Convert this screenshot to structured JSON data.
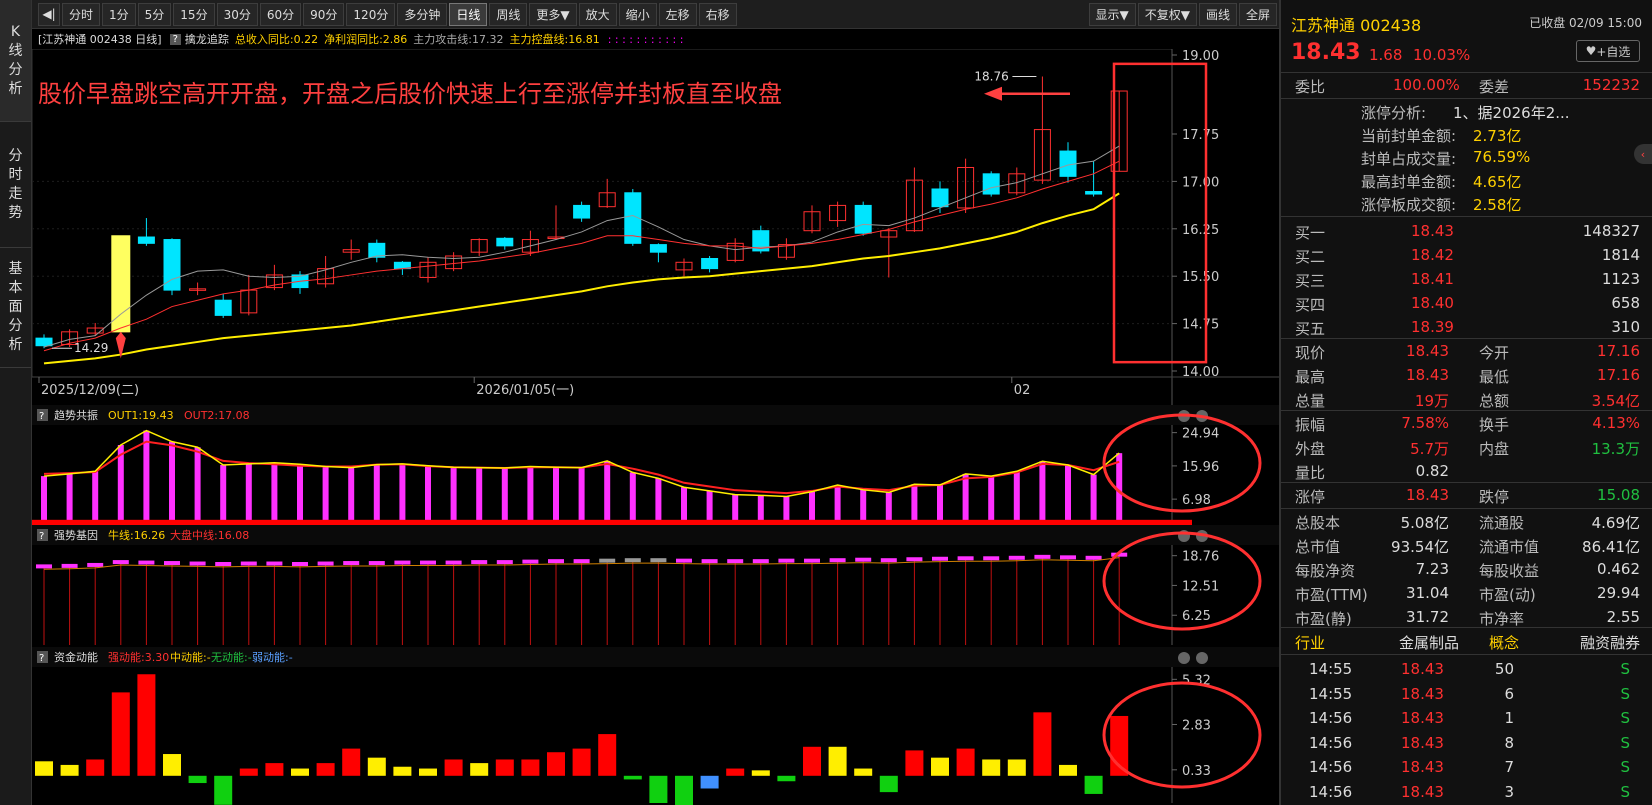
{
  "sidebar": {
    "tabs": [
      "K线分析",
      "分时走势",
      "基本面分析"
    ]
  },
  "toolbar": {
    "items": [
      "分时",
      "1分",
      "5分",
      "15分",
      "30分",
      "60分",
      "90分",
      "120分",
      "多分钟",
      "日线",
      "周线",
      "更多▼",
      "放大",
      "缩小",
      "左移",
      "右移",
      "显示▼",
      "不复权▼",
      "画线",
      "全屏"
    ],
    "active": "日线"
  },
  "infobar": {
    "title": "[江苏神通 002438 日线]",
    "help": "?",
    "indicator": "擒龙追踪",
    "revenue": "总收入同比:0.22",
    "profit": "净利润同比:2.86",
    "attack": "主力攻击线:17.32",
    "control": "主力控盘线:16.81",
    "dots": ": : : : : : : : : : :"
  },
  "main_chart": {
    "annotation": "股价早盘跳空高开开盘，开盘之后股价快速上行至涨停并封板直至收盘",
    "high_label": "18.76",
    "low_label": "14.29",
    "y_ticks": [
      "19.00",
      "17.75",
      "17.00",
      "16.25",
      "15.50",
      "14.75",
      "14.00"
    ],
    "dates": [
      "2025/12/09(二)",
      "2026/01/05(一)",
      "02"
    ]
  },
  "chart_data": {
    "type": "candlestick",
    "ylim": [
      14.0,
      19.0
    ],
    "candles": [
      [
        14.52,
        14.4,
        14.58,
        14.36
      ],
      [
        14.42,
        14.62,
        14.66,
        14.38
      ],
      [
        14.6,
        14.68,
        14.76,
        14.56
      ],
      [
        14.62,
        16.12,
        16.14,
        14.58
      ],
      [
        16.12,
        16.02,
        16.42,
        15.98
      ],
      [
        16.08,
        15.28,
        16.1,
        15.2
      ],
      [
        15.3,
        15.3,
        15.4,
        15.2
      ],
      [
        15.12,
        14.88,
        15.22,
        14.84
      ],
      [
        14.92,
        15.28,
        15.52,
        14.88
      ],
      [
        15.32,
        15.52,
        15.68,
        15.28
      ],
      [
        15.52,
        15.32,
        15.58,
        15.22
      ],
      [
        15.38,
        15.62,
        15.82,
        15.32
      ],
      [
        15.88,
        15.92,
        16.08,
        15.76
      ],
      [
        16.02,
        15.8,
        16.08,
        15.72
      ],
      [
        15.72,
        15.62,
        15.74,
        15.52
      ],
      [
        15.48,
        15.72,
        15.8,
        15.4
      ],
      [
        15.62,
        15.82,
        15.88,
        15.58
      ],
      [
        15.88,
        16.08,
        16.1,
        15.82
      ],
      [
        16.1,
        15.98,
        16.12,
        15.92
      ],
      [
        15.88,
        16.08,
        16.22,
        15.82
      ],
      [
        16.12,
        16.12,
        16.62,
        16.08
      ],
      [
        16.62,
        16.42,
        16.68,
        16.36
      ],
      [
        16.6,
        16.82,
        17.04,
        16.58
      ],
      [
        16.82,
        16.02,
        16.88,
        15.98
      ],
      [
        16.0,
        15.88,
        16.02,
        15.72
      ],
      [
        15.6,
        15.72,
        15.78,
        15.5
      ],
      [
        15.78,
        15.62,
        15.82,
        15.56
      ],
      [
        15.75,
        16.02,
        16.1,
        15.72
      ],
      [
        16.22,
        15.9,
        16.3,
        15.86
      ],
      [
        15.8,
        16.0,
        16.1,
        15.76
      ],
      [
        16.22,
        16.52,
        16.62,
        16.18
      ],
      [
        16.38,
        16.62,
        16.68,
        16.28
      ],
      [
        16.62,
        16.18,
        16.68,
        16.14
      ],
      [
        16.12,
        16.22,
        16.26,
        15.48
      ],
      [
        16.22,
        17.02,
        17.22,
        16.2
      ],
      [
        16.88,
        16.6,
        17.0,
        16.5
      ],
      [
        16.58,
        17.22,
        17.36,
        16.5
      ],
      [
        17.12,
        16.8,
        17.16,
        16.76
      ],
      [
        16.82,
        17.12,
        17.22,
        16.78
      ],
      [
        17.02,
        17.82,
        18.66,
        16.96
      ],
      [
        17.48,
        17.08,
        17.62,
        16.98
      ],
      [
        16.84,
        16.8,
        17.32,
        16.76
      ],
      [
        17.16,
        18.43,
        18.43,
        17.16
      ]
    ],
    "ma_red": [
      14.32,
      14.44,
      14.52,
      14.68,
      14.82,
      15.02,
      15.12,
      15.22,
      15.28,
      15.36,
      15.42,
      15.46,
      15.52,
      15.58,
      15.62,
      15.66,
      15.7,
      15.74,
      15.8,
      15.86,
      15.94,
      16.02,
      16.14,
      16.14,
      16.08,
      16.02,
      15.98,
      15.98,
      15.94,
      15.98,
      16.02,
      16.08,
      16.16,
      16.24,
      16.36,
      16.46,
      16.56,
      16.64,
      16.74,
      16.88,
      17.0,
      17.12,
      17.32
    ],
    "ma_yel": [
      14.12,
      14.16,
      14.2,
      14.26,
      14.34,
      14.4,
      14.46,
      14.52,
      14.56,
      14.6,
      14.64,
      14.68,
      14.72,
      14.78,
      14.84,
      14.9,
      14.96,
      15.02,
      15.08,
      15.14,
      15.2,
      15.26,
      15.34,
      15.4,
      15.45,
      15.48,
      15.5,
      15.54,
      15.58,
      15.62,
      15.66,
      15.72,
      15.78,
      15.82,
      15.88,
      15.94,
      16.02,
      16.1,
      16.2,
      16.34,
      16.46,
      16.56,
      16.81
    ],
    "ma_gry": [
      14.38,
      14.5,
      14.56,
      14.9,
      15.2,
      15.45,
      15.58,
      15.6,
      15.5,
      15.48,
      15.5,
      15.6,
      15.72,
      15.82,
      15.84,
      15.8,
      15.78,
      15.8,
      15.88,
      15.98,
      16.08,
      16.2,
      16.38,
      16.46,
      16.28,
      16.08,
      15.98,
      15.92,
      15.96,
      15.98,
      16.04,
      16.2,
      16.32,
      16.3,
      16.42,
      16.58,
      16.74,
      16.9,
      16.98,
      17.12,
      17.26,
      17.32,
      17.56
    ],
    "trend": {
      "title": "趋势共振",
      "out1": "OUT1:19.43",
      "out2": "OUT2:17.08",
      "ticks": [
        "24.94",
        "15.96",
        "6.98"
      ],
      "ylim": [
        0,
        27
      ],
      "bars": [
        13.2,
        13.8,
        14.5,
        21.6,
        25.5,
        22.5,
        21.0,
        16.2,
        16.5,
        16.8,
        16.4,
        15.8,
        15.5,
        16.3,
        16.5,
        16.0,
        15.6,
        15.5,
        15.4,
        15.8,
        15.6,
        15.5,
        17.3,
        14.2,
        12.6,
        10.2,
        9.2,
        8.2,
        8.0,
        7.7,
        9.0,
        10.8,
        9.5,
        8.8,
        11.0,
        10.8,
        13.8,
        13.2,
        14.5,
        17.2,
        16.2,
        13.6,
        19.4
      ],
      "line_red": [
        13.8,
        14.0,
        14.3,
        19.0,
        22.5,
        21.5,
        19.8,
        17.3,
        16.7,
        16.4,
        16.0,
        15.8,
        15.8,
        16.3,
        16.4,
        15.9,
        15.6,
        15.5,
        15.4,
        15.6,
        15.6,
        15.5,
        16.5,
        15.2,
        13.6,
        11.4,
        10.4,
        9.4,
        9.0,
        8.6,
        9.2,
        10.4,
        9.8,
        9.4,
        10.6,
        10.8,
        12.6,
        13.0,
        14.2,
        16.5,
        16.2,
        14.8,
        17.08
      ],
      "line_yel": [
        13.2,
        13.8,
        14.5,
        21.6,
        25.5,
        22.5,
        21.0,
        16.2,
        16.5,
        16.8,
        16.4,
        15.8,
        15.5,
        16.3,
        16.5,
        16.0,
        15.6,
        15.5,
        15.4,
        15.8,
        15.6,
        15.5,
        17.3,
        14.2,
        12.6,
        10.2,
        9.2,
        8.2,
        8.0,
        7.7,
        9.0,
        10.8,
        9.5,
        8.8,
        11.0,
        10.8,
        13.8,
        13.2,
        14.5,
        17.2,
        16.2,
        13.6,
        19.43
      ]
    },
    "strong": {
      "title": "强势基因",
      "bull": "牛线:16.26",
      "market": "大盘中线:16.08",
      "ticks": [
        "18.76",
        "12.51",
        "6.25"
      ],
      "ylim": [
        0,
        21
      ],
      "bars": [
        16.3,
        16.4,
        16.6,
        17.2,
        17.1,
        17.0,
        16.9,
        16.8,
        16.9,
        16.9,
        16.8,
        16.9,
        17.0,
        17.0,
        17.1,
        17.1,
        17.1,
        17.2,
        17.2,
        17.3,
        17.4,
        17.4,
        17.5,
        17.6,
        17.6,
        17.5,
        17.4,
        17.4,
        17.4,
        17.5,
        17.5,
        17.6,
        17.7,
        17.6,
        17.8,
        17.9,
        18.0,
        18.0,
        18.1,
        18.3,
        18.2,
        18.1,
        18.76
      ]
    },
    "fund": {
      "title": "资金动能",
      "strong": "强动能:3.30",
      "mid": "中动能:-",
      "none": "无动能:-",
      "weak": "弱动能:-",
      "ticks": [
        "5.32",
        "2.83",
        "0.33"
      ],
      "ylim": [
        -1.5,
        6.0
      ],
      "bars": [
        0.8,
        0.6,
        0.9,
        4.6,
        5.6,
        1.2,
        -0.4,
        -1.6,
        0.4,
        0.7,
        0.4,
        0.7,
        1.5,
        1.0,
        0.5,
        0.4,
        0.9,
        0.7,
        0.9,
        0.9,
        1.3,
        1.5,
        2.3,
        -0.2,
        -1.5,
        -2.0,
        -0.7,
        0.4,
        0.3,
        -0.3,
        1.6,
        1.6,
        0.4,
        -0.9,
        1.4,
        1.0,
        1.5,
        0.9,
        0.9,
        3.5,
        0.6,
        -1.0,
        3.3
      ],
      "colors": [
        "yel",
        "yel",
        "red",
        "red",
        "red",
        "yel",
        "grn",
        "grn",
        "red",
        "red",
        "yel",
        "red",
        "red",
        "yel",
        "yel",
        "yel",
        "red",
        "yel",
        "red",
        "red",
        "red",
        "red",
        "red",
        "grn",
        "grn",
        "grn",
        "blu",
        "red",
        "yel",
        "grn",
        "red",
        "yel",
        "yel",
        "grn",
        "red",
        "yel",
        "red",
        "yel",
        "yel",
        "red",
        "yel",
        "grn",
        "red"
      ]
    }
  },
  "right_panel": {
    "stock_name": "江苏神通 002438",
    "status": "已收盘 02/09 15:00",
    "price": "18.43",
    "change": "1.68",
    "change_pct": "10.03%",
    "fav": "+自选",
    "weibi_label": "委比",
    "weibi": "100.00%",
    "weicha_label": "委差",
    "weicha": "152232",
    "zt": [
      [
        "涨停分析:",
        "1、据2026年2..."
      ],
      [
        "当前封单金额:",
        "2.73亿"
      ],
      [
        "封单占成交量:",
        "76.59%"
      ],
      [
        "最高封单金额:",
        "4.65亿"
      ],
      [
        "涨停板成交额:",
        "2.58亿"
      ]
    ],
    "bids": [
      [
        "买一",
        "18.43",
        "148327"
      ],
      [
        "买二",
        "18.42",
        "1814"
      ],
      [
        "买三",
        "18.41",
        "1123"
      ],
      [
        "买四",
        "18.40",
        "658"
      ],
      [
        "买五",
        "18.39",
        "310"
      ]
    ],
    "stats1": [
      [
        "现价",
        "18.43",
        "今开",
        "17.16"
      ],
      [
        "最高",
        "18.43",
        "最低",
        "17.16"
      ],
      [
        "总量",
        "19万",
        "总额",
        "3.54亿"
      ]
    ],
    "stats2": [
      [
        "振幅",
        "7.58%",
        "换手",
        "4.13%"
      ],
      [
        "外盘",
        "5.7万",
        "内盘",
        "13.3万"
      ],
      [
        "量比",
        "0.82",
        "",
        ""
      ]
    ],
    "stats3": [
      [
        "涨停",
        "18.43",
        "跌停",
        "15.08"
      ]
    ],
    "stats4": [
      [
        "总股本",
        "5.08亿",
        "流通股",
        "4.69亿"
      ],
      [
        "总市值",
        "93.54亿",
        "流通市值",
        "86.41亿"
      ],
      [
        "每股净资",
        "7.23",
        "每股收益",
        "0.462"
      ],
      [
        "市盈(TTM)",
        "31.04",
        "市盈(动)",
        "29.94"
      ],
      [
        "市盈(静)",
        "31.72",
        "市净率",
        "2.55"
      ]
    ],
    "industry": [
      "行业",
      "金属制品",
      "概念",
      "融资融券"
    ],
    "ticks": [
      [
        "14:55",
        "18.43",
        "50",
        "S"
      ],
      [
        "14:55",
        "18.43",
        "6",
        "S"
      ],
      [
        "14:56",
        "18.43",
        "1",
        "S"
      ],
      [
        "14:56",
        "18.43",
        "8",
        "S"
      ],
      [
        "14:56",
        "18.43",
        "7",
        "S"
      ],
      [
        "14:56",
        "18.43",
        "3",
        "S"
      ]
    ]
  }
}
